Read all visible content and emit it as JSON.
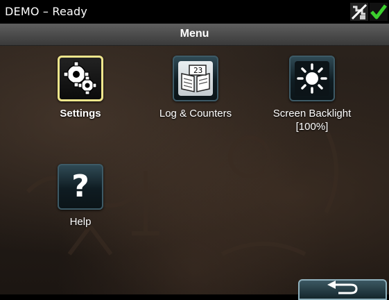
{
  "status": {
    "text": "DEMO – Ready",
    "icons": [
      "network-disconnected-icon",
      "check-icon"
    ]
  },
  "header": {
    "title": "Menu"
  },
  "menu": {
    "items": [
      {
        "label": "Settings",
        "icon": "gears-icon",
        "selected": true
      },
      {
        "label": "Log & Counters",
        "icon": "log-book-icon",
        "counter_digits": "23"
      },
      {
        "label": "Screen Backlight",
        "sublabel": "[100%]",
        "icon": "sun-icon"
      },
      {
        "label": "Help",
        "icon": "question-icon",
        "glyph": "?"
      }
    ]
  },
  "footer": {
    "back_icon": "back-arrow-icon"
  },
  "colors": {
    "selected_border": "#f0e68c",
    "check_green": "#3ccf2e",
    "tile_border": "#3d5a66"
  }
}
